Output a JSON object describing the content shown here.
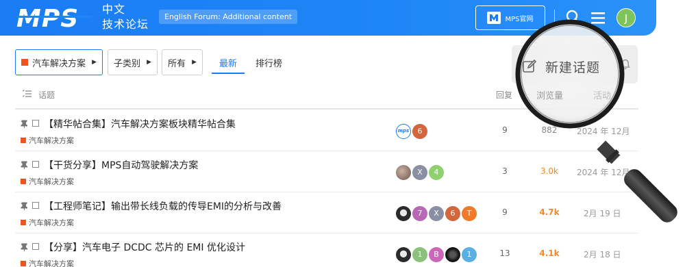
{
  "header": {
    "logo_text": "MPS",
    "site_name_line1": "中文",
    "site_name_line2": "技术论坛",
    "english_forum_label": "English Forum: Additional content",
    "mps_site_label": "MPS官网",
    "avatar_initial": "J",
    "brand_color": "#1a7cf5",
    "avatar_color": "#7ec35b"
  },
  "filters": {
    "category_label": "汽车解决方案",
    "subcategory_label": "子类别",
    "tags_label": "所有",
    "tabs": [
      {
        "label": "最新",
        "active": true
      },
      {
        "label": "排行榜",
        "active": false
      }
    ]
  },
  "actions": {
    "new_topic_label": "新建话题"
  },
  "columns": {
    "topic": "话题",
    "replies": "回复",
    "views": "浏览量",
    "activity": "活动"
  },
  "topics": [
    {
      "title": "【精华帖合集】汽车解决方案板块精华帖合集",
      "category": "汽车解决方案",
      "replies": "9",
      "views": "882",
      "activity": "2024 年 12月",
      "posters": [
        {
          "label": "mps",
          "color": "#ffffff"
        },
        {
          "label": "6",
          "color": "#d3663c"
        }
      ]
    },
    {
      "title": "【干货分享】MPS自动驾驶解决方案",
      "category": "汽车解决方案",
      "replies": "3",
      "views": "3.0k",
      "activity": "2024 年 12月",
      "posters": [
        {
          "label": "",
          "color": "#8b6f63"
        },
        {
          "label": "X",
          "color": "#8a8fa3"
        },
        {
          "label": "4",
          "color": "#8fd16f"
        }
      ]
    },
    {
      "title": "【工程师笔记】输出带长线负载的传导EMI的分析与改善",
      "category": "汽车解决方案",
      "replies": "9",
      "views": "4.7k",
      "activity": "2月 19 日",
      "posters": [
        {
          "label": "",
          "color": "#3b3b3b"
        },
        {
          "label": "7",
          "color": "#b769b6"
        },
        {
          "label": "X",
          "color": "#8a8fa3"
        },
        {
          "label": "6",
          "color": "#d3663c"
        },
        {
          "label": "T",
          "color": "#f07a2a"
        }
      ]
    },
    {
      "title": "【分享】汽车电子 DCDC 芯片的 EMI 优化设计",
      "category": "汽车解决方案",
      "replies": "13",
      "views": "4.1k",
      "activity": "2月 18 日",
      "posters": [
        {
          "label": "",
          "color": "#3b3b3b"
        },
        {
          "label": "1",
          "color": "#8bc17a"
        },
        {
          "label": "B",
          "color": "#c968b8"
        },
        {
          "label": "",
          "color": "#222222"
        },
        {
          "label": "1",
          "color": "#5ab0e4"
        }
      ]
    }
  ],
  "accent_colors": {
    "category_square": "#f0531d",
    "hot_views": "#f08a2a"
  }
}
